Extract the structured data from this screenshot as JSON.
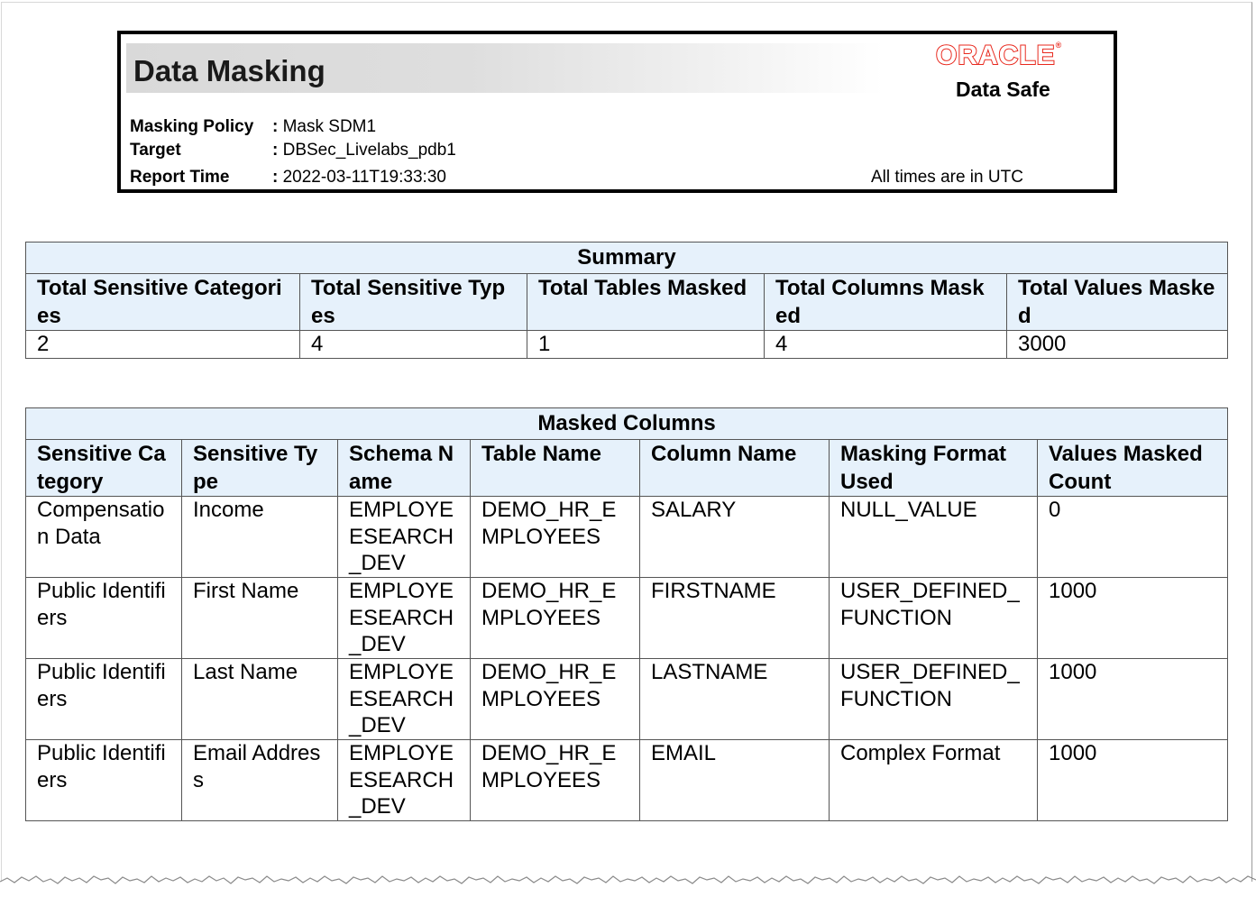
{
  "report": {
    "title": "Data Masking",
    "brand": {
      "logo_text": "ORACLE",
      "product": "Data Safe",
      "accent_color": "#e8281d"
    },
    "meta": [
      {
        "label": "Masking Policy",
        "sep": ":",
        "value": "Mask SDM1"
      },
      {
        "label": "Target",
        "sep": ":",
        "value": "DBSec_Livelabs_pdb1"
      },
      {
        "label": "Report Time",
        "sep": ":",
        "value": "2022-03-11T19:33:30"
      }
    ],
    "timezone_note": "All times are in UTC"
  },
  "summary": {
    "caption": "Summary",
    "columns": [
      "Total Sensitive Categories",
      "Total Sensitive Types",
      "Total Tables Masked",
      "Total Columns Masked",
      "Total Values Masked"
    ],
    "values": [
      "2",
      "4",
      "1",
      "4",
      "3000"
    ]
  },
  "masked_columns": {
    "caption": "Masked Columns",
    "columns": [
      "Sensitive Category",
      "Sensitive Type",
      "Schema Name",
      "Table Name",
      "Column Name",
      "Masking Format Used",
      "Values Masked Count"
    ],
    "rows": [
      [
        "Compensation Data",
        "Income",
        "EMPLOYEESEARCH_DEV",
        "DEMO_HR_EMPLOYEES",
        "SALARY",
        "NULL_VALUE",
        "0"
      ],
      [
        "Public Identifiers",
        "First Name",
        "EMPLOYEESEARCH_DEV",
        "DEMO_HR_EMPLOYEES",
        "FIRSTNAME",
        "USER_DEFINED_FUNCTION",
        "1000"
      ],
      [
        "Public Identifiers",
        "Last Name",
        "EMPLOYEESEARCH_DEV",
        "DEMO_HR_EMPLOYEES",
        "LASTNAME",
        "USER_DEFINED_FUNCTION",
        "1000"
      ],
      [
        "Public Identifiers",
        "Email Address",
        "EMPLOYEESEARCH_DEV",
        "DEMO_HR_EMPLOYEES",
        "EMAIL",
        "Complex Format",
        "1000"
      ]
    ]
  },
  "header_background": "#e6f1fb"
}
